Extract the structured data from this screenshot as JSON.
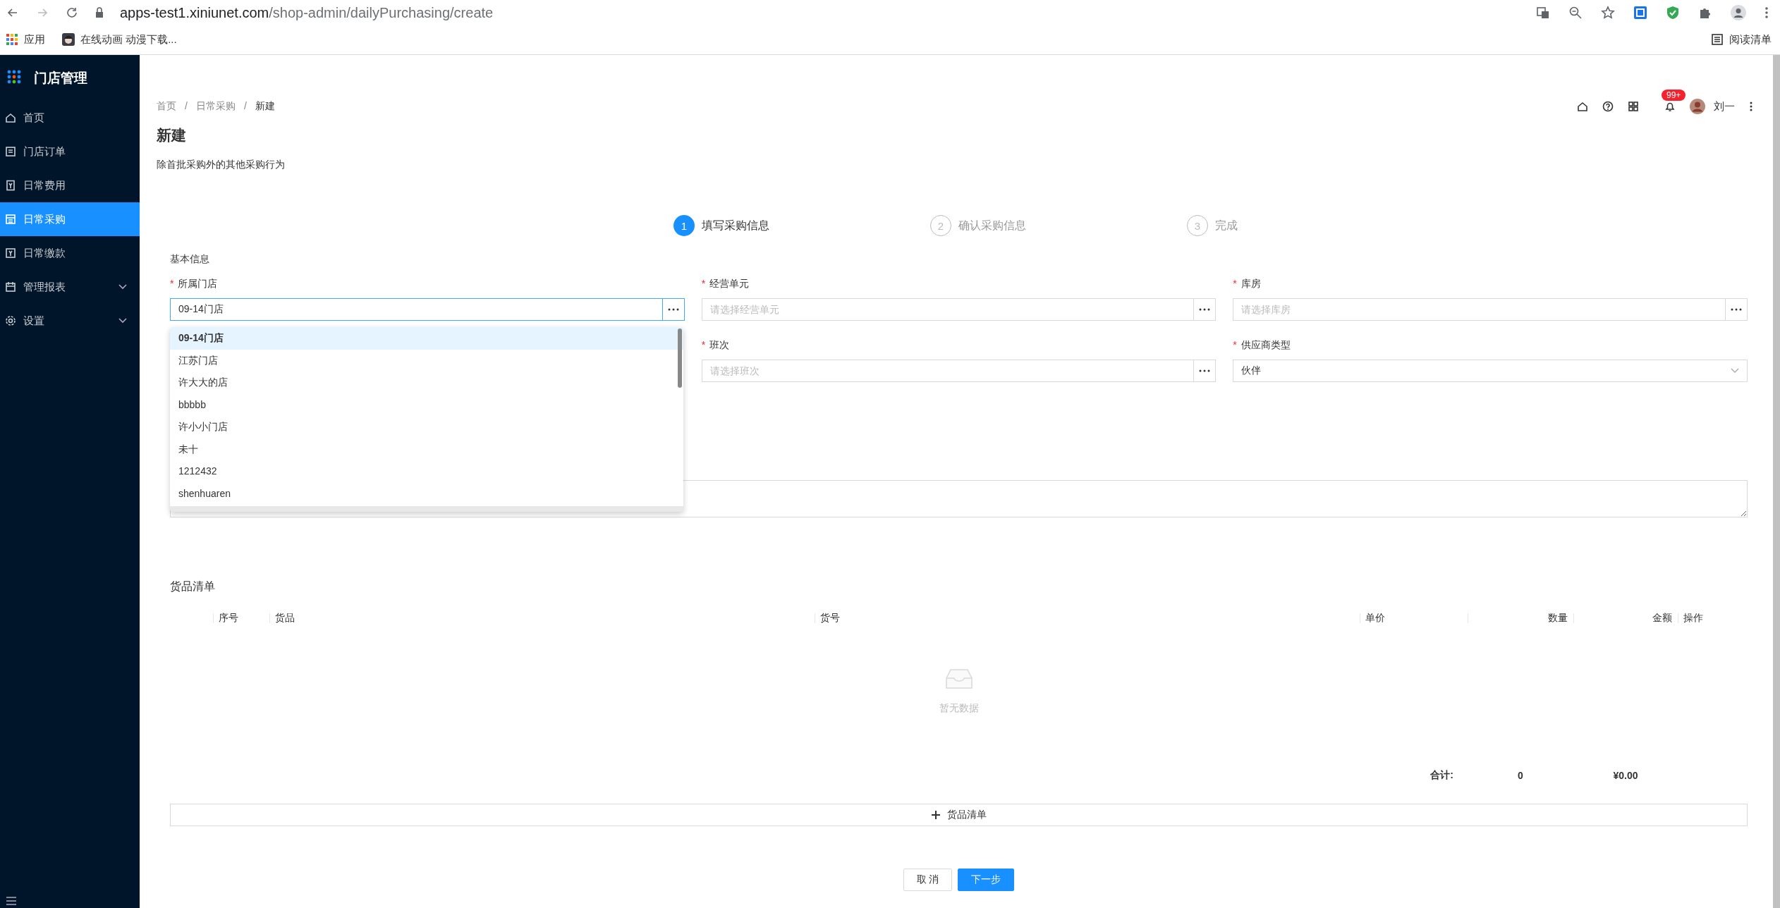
{
  "browser": {
    "url_host": "apps-test1.xiniunet.com",
    "url_path": "/shop-admin/dailyPurchasing/create",
    "bookmarks": [
      {
        "label": "应用"
      },
      {
        "label": "在线动画 动漫下载..."
      }
    ],
    "reading_list": "阅读清单"
  },
  "sidebar": {
    "title": "门店管理",
    "items": [
      {
        "label": "首页",
        "selected": false,
        "expandable": false
      },
      {
        "label": "门店订单",
        "selected": false,
        "expandable": false
      },
      {
        "label": "日常费用",
        "selected": false,
        "expandable": false
      },
      {
        "label": "日常采购",
        "selected": true,
        "expandable": false
      },
      {
        "label": "日常缴款",
        "selected": false,
        "expandable": false
      },
      {
        "label": "管理报表",
        "selected": false,
        "expandable": true
      },
      {
        "label": "设置",
        "selected": false,
        "expandable": true
      }
    ]
  },
  "header": {
    "notification_badge": "99+",
    "user_name": "刘一"
  },
  "breadcrumb": [
    {
      "kind": "link",
      "label": "首页",
      "current": false
    },
    {
      "kind": "separator",
      "label": "/"
    },
    {
      "kind": "link",
      "label": "日常采购",
      "current": false
    },
    {
      "kind": "separator",
      "label": "/"
    },
    {
      "kind": "link",
      "label": "新建",
      "current": true
    }
  ],
  "page": {
    "title": "新建",
    "description": "除首批采购外的其他采购行为"
  },
  "steps": [
    {
      "number": "1",
      "label": "填写采购信息",
      "active": true
    },
    {
      "number": "2",
      "label": "确认采购信息",
      "active": false
    },
    {
      "number": "3",
      "label": "完成",
      "active": false
    }
  ],
  "form": {
    "section_title": "基本信息",
    "fields": [
      {
        "kind": "picker",
        "required_mark": "*",
        "label": "所属门店",
        "value": "09-14门店",
        "focused": true
      },
      {
        "kind": "picker",
        "required_mark": "*",
        "label": "经营单元",
        "placeholder": "请选择经营单元",
        "focused": false
      },
      {
        "kind": "picker",
        "required_mark": "*",
        "label": "库房",
        "placeholder": "请选择库房",
        "focused": false
      },
      {
        "kind": "hidden"
      },
      {
        "kind": "picker",
        "required_mark": "*",
        "label": "班次",
        "placeholder": "请选择班次",
        "focused": false
      },
      {
        "kind": "select",
        "required_mark": "*",
        "label": "供应商类型",
        "value": "伙伴",
        "focused": false
      },
      {
        "kind": "textarea"
      }
    ]
  },
  "dropdown": {
    "options": [
      {
        "label": "09-14门店",
        "selected": true
      },
      {
        "label": "江苏门店",
        "selected": false
      },
      {
        "label": "许大大的店",
        "selected": false
      },
      {
        "label": "bbbbb",
        "selected": false
      },
      {
        "label": "许小小门店",
        "selected": false
      },
      {
        "label": "未十",
        "selected": false
      },
      {
        "label": "1212432",
        "selected": false
      },
      {
        "label": "shenhuaren",
        "selected": false
      }
    ]
  },
  "goods": {
    "title": "货品清单",
    "columns": [
      {
        "label": "序号"
      },
      {
        "label": "货品"
      },
      {
        "label": "货号"
      },
      {
        "label": "单价"
      },
      {
        "label": "数量"
      },
      {
        "label": "金额"
      },
      {
        "label": "操作"
      }
    ],
    "empty_text": "暂无数据",
    "totals": {
      "label": "合计:",
      "quantity": "0",
      "amount": "¥0.00"
    },
    "add_button": "货品清单"
  },
  "actions": [
    {
      "label": "取 消",
      "kind": "default"
    },
    {
      "label": "下一步",
      "kind": "primary"
    }
  ]
}
